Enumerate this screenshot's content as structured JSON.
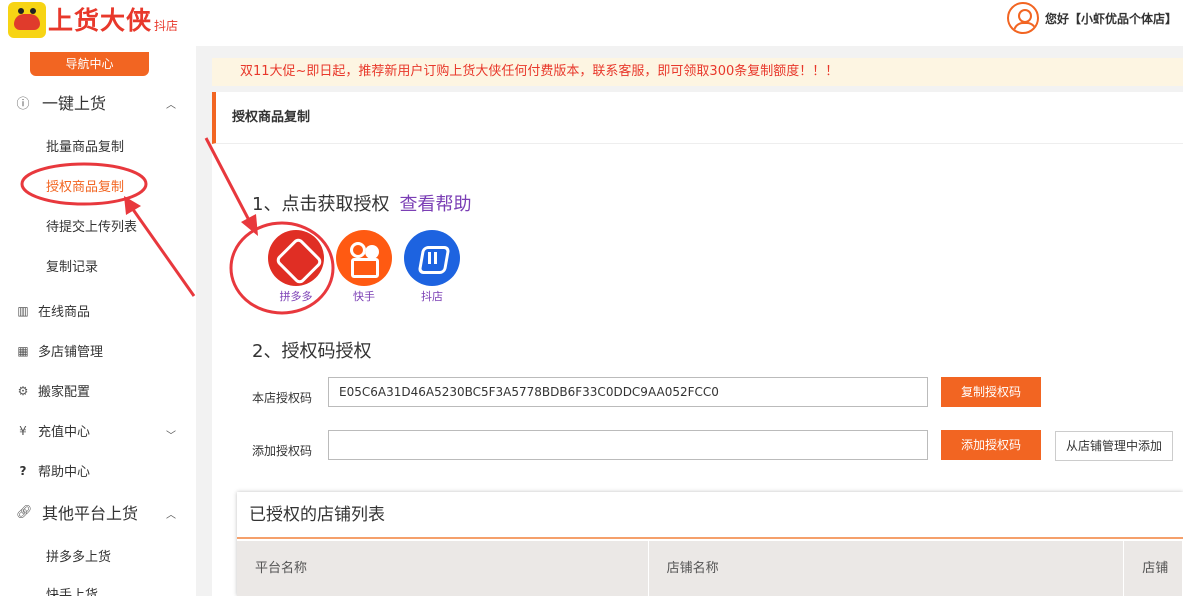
{
  "header": {
    "logo_text": "上货大侠",
    "logo_sub": "抖店",
    "greeting": "您好【小虾优品个体店】"
  },
  "sidebar": {
    "nav_center": "导航中心",
    "groups": [
      {
        "label": "一键上货",
        "icon": "info-circle-icon"
      },
      {
        "label": "其他平台上货",
        "icon": "link-icon"
      }
    ],
    "sub_items_1": [
      "批量商品复制",
      "授权商品复制",
      "待提交上传列表",
      "复制记录"
    ],
    "items": [
      {
        "label": "在线商品",
        "icon": "grid-icon"
      },
      {
        "label": "多店铺管理",
        "icon": "apps-icon"
      },
      {
        "label": "搬家配置",
        "icon": "gear-icon"
      },
      {
        "label": "充值中心",
        "icon": "yen-icon"
      },
      {
        "label": "帮助中心",
        "icon": "question-icon"
      }
    ],
    "sub_items_2": [
      "拼多多上货",
      "快手上货"
    ]
  },
  "notice": "双11大促~即日起，推荐新用户订购上货大侠任何付费版本，联系客服，即可领取300条复制额度！！！",
  "content": {
    "title": "授权商品复制",
    "step1": "1、点击获取授权",
    "help_link": "查看帮助",
    "platforms": [
      {
        "name": "拼多多",
        "icon": "pinduoduo-logo-icon",
        "color": "#e02e24"
      },
      {
        "name": "快手",
        "icon": "kuaishou-logo-icon",
        "color": "#ff5a12"
      },
      {
        "name": "抖店",
        "icon": "doudian-logo-icon",
        "color": "#1d63e0"
      }
    ],
    "step2": "2、授权码授权",
    "store_code_label": "本店授权码",
    "store_code_value": "E05C6A31D46A5230BC5F3A5778BDB6F33C0DDC9AA052FCC0",
    "copy_code_btn": "复制授权码",
    "add_code_label": "添加授权码",
    "add_code_value": "",
    "add_code_btn": "添加授权码",
    "add_from_store_btn": "从店铺管理中添加"
  },
  "table": {
    "title": "已授权的店铺列表",
    "columns": [
      "平台名称",
      "店铺名称",
      "店铺"
    ]
  },
  "colors": {
    "accent": "#f26522",
    "notice_text": "#e8382b",
    "link": "#7b3fb5",
    "annotation": "#e8383d"
  }
}
